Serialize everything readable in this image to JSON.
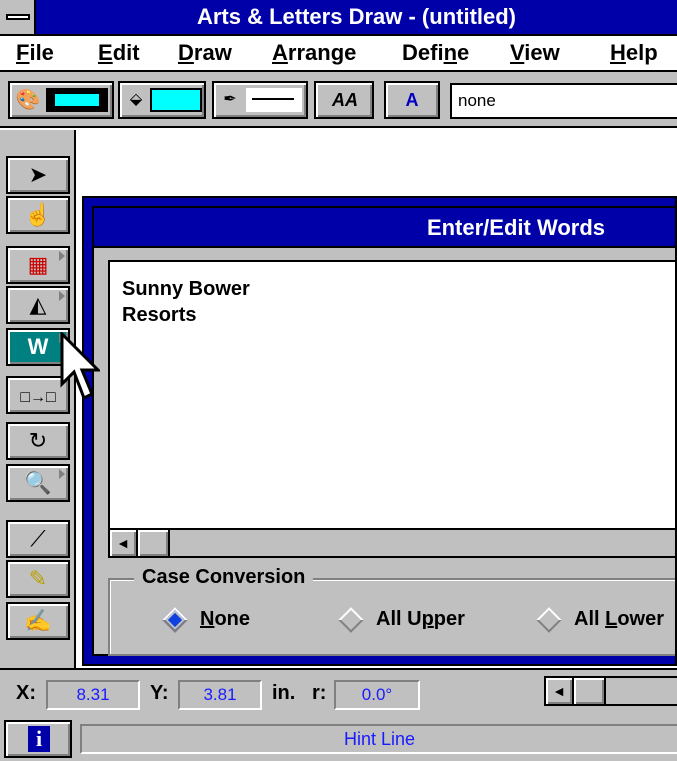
{
  "window": {
    "title": "Arts & Letters Draw - (untitled)"
  },
  "menu": [
    {
      "label": "File",
      "underline": "F"
    },
    {
      "label": "Edit",
      "underline": "E"
    },
    {
      "label": "Draw",
      "underline": "D"
    },
    {
      "label": "Arrange",
      "underline": "A"
    },
    {
      "label": "Define",
      "underline": "n"
    },
    {
      "label": "View",
      "underline": "V"
    },
    {
      "label": "Help",
      "underline": "H"
    }
  ],
  "toolbar": {
    "fill_color": "#000000",
    "fill_inner": "#00ffff",
    "line_color": "#00ffff",
    "type_label": "AA",
    "style_combo_value": "none"
  },
  "palette": {
    "active_tool_label": "W"
  },
  "dialog": {
    "title": "Enter/Edit Words",
    "text": "Sunny Bower\nResorts",
    "case_group_label": "Case Conversion",
    "options": [
      {
        "label": "None",
        "underline_char": "N",
        "selected": true
      },
      {
        "label": "All Upper",
        "underline_char": "p",
        "selected": false
      },
      {
        "label": "All Lower",
        "underline_char": "L",
        "selected": false
      }
    ]
  },
  "status": {
    "x_label": "X:",
    "x_value": "8.31",
    "y_label": "Y:",
    "y_value": "3.81",
    "units_label": "in.",
    "r_label": "r:",
    "r_value": "0.0°",
    "hint": "Hint Line"
  },
  "colors": {
    "titlebar": "#0000a8",
    "chrome": "#c0c0c0",
    "active_tool": "#008080",
    "status_text": "#1a1aff"
  }
}
